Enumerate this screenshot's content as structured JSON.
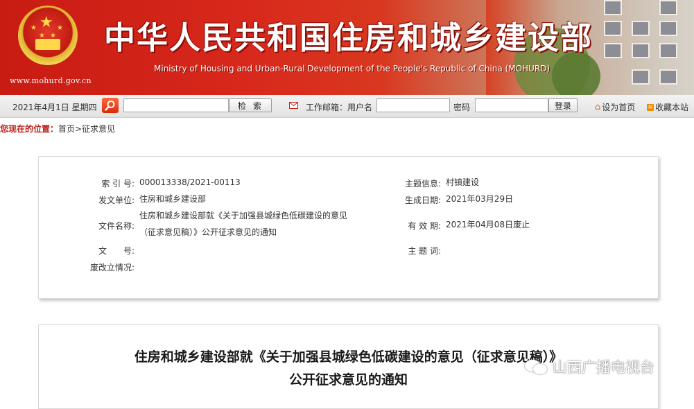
{
  "header": {
    "title_cn": "中华人民共和国住房和城乡建设部",
    "title_en": "Ministry of Housing and Urban-Rural Development of the People's Republic of China (MOHURD)",
    "site_url": "www.mohurd.gov.cn"
  },
  "toolbar": {
    "date": "2021年4月1日 星期四",
    "search_value": "",
    "search_button": "检索",
    "mail_label": "工作邮箱：用户名",
    "username_value": "",
    "password_label": "密码",
    "password_value": "",
    "login_button": "登录",
    "set_home": "设为首页",
    "bookmark": "收藏本站"
  },
  "breadcrumb": {
    "lead": "您现在的位置：",
    "home": "首页",
    "sep": ">",
    "current": "征求意见"
  },
  "meta": {
    "index_no_label": "索 引 号:",
    "index_no": "000013338/2021-00113",
    "issuer_label": "发文单位:",
    "issuer": "住房和城乡建设部",
    "doc_name_label": "文件名称:",
    "doc_name": "住房和城乡建设部就《关于加强县城绿色低碳建设的意见（征求意见稿）》公开征求意见的通知",
    "doc_no_label": "文　　号:",
    "doc_no": "",
    "status_label": "废改立情况:",
    "status": "",
    "topic_label": "主题信息:",
    "topic": "村镇建设",
    "created_label": "生成日期:",
    "created": "2021年03月29日",
    "validity_label": "有 效 期:",
    "validity": "2021年04月08日废止",
    "keywords_label": "主 题 词:",
    "keywords": ""
  },
  "article": {
    "title_line1": "住房和城乡建设部就《关于加强县城绿色低碳建设的意见（征求意见稿）》",
    "title_line2": "公开征求意见的通知"
  },
  "watermark": {
    "text": "山西广播电视台"
  }
}
